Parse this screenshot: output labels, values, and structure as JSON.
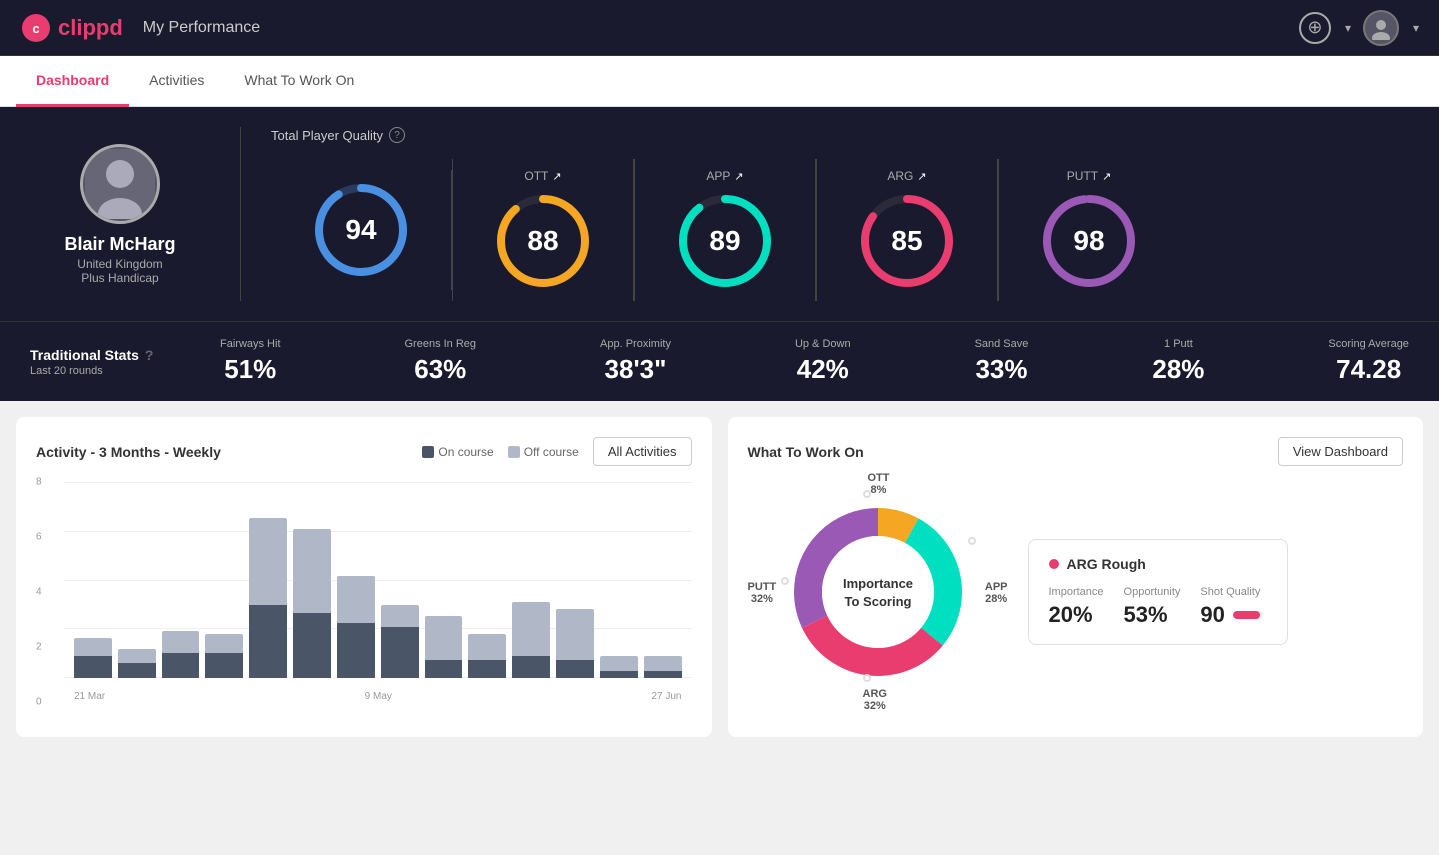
{
  "header": {
    "logo": "clippd",
    "title": "My Performance",
    "add_button_label": "+",
    "chevron": "▾"
  },
  "tabs": [
    {
      "id": "dashboard",
      "label": "Dashboard",
      "active": true
    },
    {
      "id": "activities",
      "label": "Activities",
      "active": false
    },
    {
      "id": "what-to-work-on",
      "label": "What To Work On",
      "active": false
    }
  ],
  "player": {
    "name": "Blair McHarg",
    "country": "United Kingdom",
    "handicap": "Plus Handicap"
  },
  "tpq": {
    "label": "Total Player Quality",
    "score": 94,
    "metrics": [
      {
        "id": "ott",
        "label": "OTT",
        "value": 88,
        "color_start": "#f5a623",
        "color_end": "#f5d020",
        "track": "#3a3a4a"
      },
      {
        "id": "app",
        "label": "APP",
        "value": 89,
        "color_start": "#00e0c0",
        "color_end": "#00b894",
        "track": "#3a3a4a"
      },
      {
        "id": "arg",
        "label": "ARG",
        "value": 85,
        "color_start": "#e83d6e",
        "color_end": "#ff6b9d",
        "track": "#3a3a4a"
      },
      {
        "id": "putt",
        "label": "PUTT",
        "value": 98,
        "color_start": "#9b59b6",
        "color_end": "#8e44ad",
        "track": "#3a3a4a"
      }
    ]
  },
  "traditional_stats": {
    "label": "Traditional Stats",
    "sub_label": "Last 20 rounds",
    "items": [
      {
        "id": "fairways",
        "label": "Fairways Hit",
        "value": "51%"
      },
      {
        "id": "greens",
        "label": "Greens In Reg",
        "value": "63%"
      },
      {
        "id": "proximity",
        "label": "App. Proximity",
        "value": "38'3\""
      },
      {
        "id": "updown",
        "label": "Up & Down",
        "value": "42%"
      },
      {
        "id": "sandsave",
        "label": "Sand Save",
        "value": "33%"
      },
      {
        "id": "oneputt",
        "label": "1 Putt",
        "value": "28%"
      },
      {
        "id": "scoring",
        "label": "Scoring Average",
        "value": "74.28"
      }
    ]
  },
  "activity_chart": {
    "title": "Activity - 3 Months - Weekly",
    "legend": {
      "on_course": "On course",
      "off_course": "Off course"
    },
    "all_activities_btn": "All Activities",
    "y_labels": [
      "8",
      "6",
      "4",
      "2",
      "0"
    ],
    "x_labels": [
      "21 Mar",
      "9 May",
      "27 Jun"
    ],
    "bars": [
      {
        "on": 12,
        "off": 10
      },
      {
        "on": 8,
        "off": 8
      },
      {
        "on": 14,
        "off": 12
      },
      {
        "on": 14,
        "off": 10
      },
      {
        "on": 40,
        "off": 48
      },
      {
        "on": 36,
        "off": 46
      },
      {
        "on": 30,
        "off": 26
      },
      {
        "on": 28,
        "off": 12
      },
      {
        "on": 10,
        "off": 24
      },
      {
        "on": 10,
        "off": 14
      },
      {
        "on": 12,
        "off": 30
      },
      {
        "on": 10,
        "off": 28
      },
      {
        "on": 4,
        "off": 8
      },
      {
        "on": 4,
        "off": 8
      }
    ],
    "colors": {
      "on_course": "#4a5568",
      "off_course": "#b0b8c8"
    }
  },
  "what_to_work_on": {
    "title": "What To Work On",
    "view_dashboard_btn": "View Dashboard",
    "donut_center": "Importance\nTo Scoring",
    "segments": [
      {
        "id": "ott",
        "label": "OTT",
        "value": 8,
        "pct": "8%",
        "color": "#f5a623"
      },
      {
        "id": "app",
        "label": "APP",
        "value": 28,
        "pct": "28%",
        "color": "#00e0c0"
      },
      {
        "id": "arg",
        "label": "ARG",
        "value": 32,
        "pct": "32%",
        "color": "#e83d6e"
      },
      {
        "id": "putt",
        "label": "PUTT",
        "value": 32,
        "pct": "32%",
        "color": "#9b59b6"
      }
    ],
    "info_card": {
      "title": "ARG Rough",
      "metrics": [
        {
          "id": "importance",
          "label": "Importance",
          "value": "20%"
        },
        {
          "id": "opportunity",
          "label": "Opportunity",
          "value": "53%"
        },
        {
          "id": "shot_quality",
          "label": "Shot Quality",
          "value": "90"
        }
      ],
      "shot_quality_fill_pct": "90"
    }
  }
}
